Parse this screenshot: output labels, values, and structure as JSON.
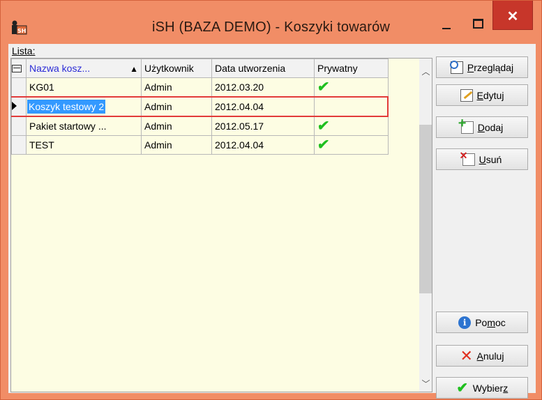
{
  "window": {
    "title": "iSH (BAZA DEMO) - Koszyki towarów",
    "close_glyph": "✕"
  },
  "list": {
    "label": "Lista:",
    "columns": [
      "Nazwa kosz...",
      "Użytkownik",
      "Data utworzenia",
      "Prywatny"
    ],
    "rows": [
      {
        "name": "KG01",
        "user": "Admin",
        "date": "2012.03.20",
        "private": true
      },
      {
        "name": "Koszyk testowy 2",
        "user": "Admin",
        "date": "2012.04.04",
        "private": false,
        "selected": true
      },
      {
        "name": "Pakiet startowy ...",
        "user": "Admin",
        "date": "2012.05.17",
        "private": true
      },
      {
        "name": "TEST",
        "user": "Admin",
        "date": "2012.04.04",
        "private": true
      }
    ]
  },
  "buttons": {
    "browse": {
      "key": "P",
      "rest": "rzeglądaj",
      "icon": "magnifier-icon"
    },
    "edit": {
      "key": "E",
      "rest": "dytuj",
      "icon": "pencil-icon"
    },
    "add": {
      "key": "D",
      "rest": "odaj",
      "icon": "add-icon"
    },
    "delete": {
      "key": "U",
      "rest": "suń",
      "icon": "delete-icon"
    },
    "help": {
      "pre": "Po",
      "key": "m",
      "rest": "oc",
      "icon": "info-icon"
    },
    "cancel": {
      "key": "A",
      "rest": "nuluj",
      "icon": "cross-icon"
    },
    "select": {
      "pre": "Wybier",
      "key": "z",
      "rest": "",
      "icon": "check-icon"
    }
  },
  "colors": {
    "titlebar": "#f18d66",
    "grid_background": "#fdfde3",
    "selection": "#3399ff",
    "checkmark": "#1fbf1f"
  }
}
